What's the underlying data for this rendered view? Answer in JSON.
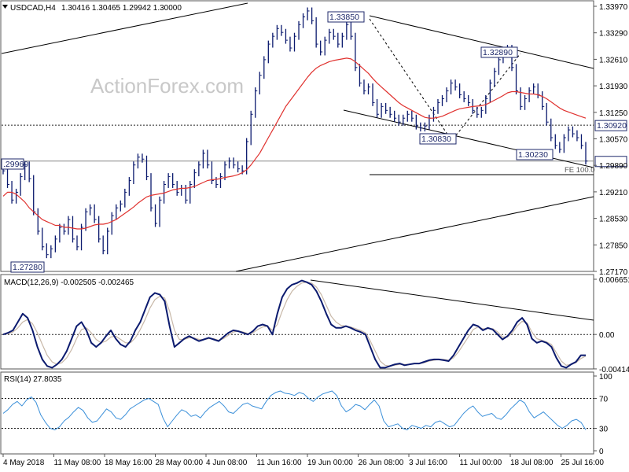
{
  "header": {
    "symbol": "USDCAD,H4",
    "ohlc": "1.30416 1.30465 1.29942 1.30000",
    "watermark": "ActionForex.com"
  },
  "colors": {
    "price_bars": "#0b1a6e",
    "moving_average": "#e0322f",
    "trendline": "#000000",
    "macd_line": "#0b1a6e",
    "macd_signal": "#c8b8a8",
    "rsi_line": "#3a8fd9",
    "grid_dotted": "#222222"
  },
  "chart_data": [
    {
      "type": "line",
      "name": "price",
      "y_axis_ticks": [
        "1.33970",
        "1.33290",
        "1.32610",
        "1.31930",
        "1.31250",
        "1.30570",
        "1.29890",
        "1.29210",
        "1.28530",
        "1.27850",
        "1.27170"
      ],
      "ylim": [
        1.2717,
        1.3397
      ],
      "x_axis_ticks": [
        "4 May 2018",
        "11 May 08:00",
        "18 May 16:00",
        "28 May 00:00",
        "4 Jun 08:00",
        "11 Jun 16:00",
        "19 Jun 00:00",
        "26 Jun 08:00",
        "3 Jul 16:00",
        "11 Jul 00:00",
        "18 Jul 08:00",
        "25 Jul 16:00"
      ],
      "series": [
        {
          "values": [
            1.2975,
            1.294,
            1.29,
            1.292,
            1.296,
            1.299,
            1.2955,
            1.287,
            1.282,
            1.278,
            1.276,
            1.2775,
            1.28,
            1.283,
            1.282,
            1.285,
            1.28,
            1.278,
            1.283,
            1.287,
            1.288,
            1.285,
            1.28,
            1.277,
            1.282,
            1.286,
            1.288,
            1.289,
            1.292,
            1.295,
            1.299,
            1.301,
            1.3005,
            1.296,
            1.288,
            1.284,
            1.29,
            1.294,
            1.296,
            1.294,
            1.292,
            1.293,
            1.29,
            1.294,
            1.297,
            1.299,
            1.302,
            1.299,
            1.295,
            1.294,
            1.296,
            1.299,
            1.3,
            1.299,
            1.298,
            1.2975,
            1.305,
            1.312,
            1.318,
            1.322,
            1.326,
            1.33,
            1.332,
            1.334,
            1.333,
            1.331,
            1.329,
            1.332,
            1.335,
            1.337,
            1.3385,
            1.336,
            1.33,
            1.328,
            1.331,
            1.333,
            1.332,
            1.33,
            1.332,
            1.335,
            1.332,
            1.324,
            1.32,
            1.318,
            1.319,
            1.315,
            1.312,
            1.314,
            1.313,
            1.312,
            1.311,
            1.31,
            1.311,
            1.312,
            1.311,
            1.309,
            1.3085,
            1.309,
            1.311,
            1.313,
            1.315,
            1.316,
            1.318,
            1.32,
            1.319,
            1.317,
            1.316,
            1.315,
            1.313,
            1.312,
            1.313,
            1.316,
            1.32,
            1.323,
            1.326,
            1.328,
            1.3289,
            1.324,
            1.318,
            1.314,
            1.316,
            1.318,
            1.319,
            1.317,
            1.314,
            1.31,
            1.306,
            1.304,
            1.303,
            1.306,
            1.308,
            1.307,
            1.306,
            1.304,
            1.3
          ]
        },
        {
          "name": "MA",
          "values": [
            1.291,
            1.292,
            1.292,
            1.2915,
            1.2905,
            1.2895,
            1.288,
            1.287,
            1.286,
            1.285,
            1.2845,
            1.284,
            1.2835,
            1.2835,
            1.283,
            1.283,
            1.2828,
            1.2826,
            1.2826,
            1.2828,
            1.2832,
            1.2836,
            1.2838,
            1.2838,
            1.284,
            1.2845,
            1.285,
            1.2858,
            1.2866,
            1.2874,
            1.2882,
            1.2892,
            1.29,
            1.2908,
            1.2912,
            1.2914,
            1.2916,
            1.2918,
            1.2922,
            1.2926,
            1.2928,
            1.293,
            1.293,
            1.2932,
            1.2935,
            1.294,
            1.2945,
            1.295,
            1.2952,
            1.2953,
            1.2955,
            1.2958,
            1.296,
            1.2962,
            1.2965,
            1.297,
            1.2978,
            1.299,
            1.3005,
            1.302,
            1.304,
            1.306,
            1.308,
            1.31,
            1.312,
            1.314,
            1.3155,
            1.317,
            1.3185,
            1.32,
            1.3215,
            1.3228,
            1.3238,
            1.3245,
            1.325,
            1.3255,
            1.3258,
            1.326,
            1.3262,
            1.3264,
            1.3262,
            1.3255,
            1.3245,
            1.3235,
            1.3225,
            1.3212,
            1.32,
            1.319,
            1.318,
            1.317,
            1.316,
            1.315,
            1.3142,
            1.3136,
            1.313,
            1.3124,
            1.3118,
            1.3112,
            1.311,
            1.311,
            1.3112,
            1.3115,
            1.312,
            1.3125,
            1.313,
            1.3134,
            1.3136,
            1.3138,
            1.314,
            1.3141,
            1.3142,
            1.3145,
            1.315,
            1.3156,
            1.3162,
            1.3168,
            1.3175,
            1.3178,
            1.3178,
            1.3176,
            1.3174,
            1.3172,
            1.3172,
            1.317,
            1.3166,
            1.316,
            1.3152,
            1.3144,
            1.3136,
            1.313,
            1.3126,
            1.3122,
            1.3118,
            1.3114,
            1.311
          ]
        }
      ],
      "annotations": [
        "1.33850",
        "1.32890",
        "1.30830",
        "1.30230",
        "1.30920",
        "1.30000",
        "1.27280",
        ".29960",
        "FE 100.0"
      ]
    },
    {
      "type": "line",
      "name": "MACD(12,26,9)",
      "title": "MACD(12,26,9) -0.002505 -0.002465",
      "y_axis_ticks": [
        "0.006651",
        "0.00",
        "-0.004145"
      ],
      "ylim": [
        -0.00415,
        0.00665
      ],
      "series": [
        {
          "values": [
            0.0,
            0.0002,
            0.0005,
            0.0015,
            0.0025,
            0.002,
            0.0005,
            -0.0015,
            -0.003,
            -0.0038,
            -0.004,
            -0.0036,
            -0.003,
            -0.002,
            -0.0005,
            0.001,
            0.0015,
            0.0005,
            -0.001,
            -0.0015,
            -0.001,
            -0.0002,
            0.0005,
            -0.0005,
            -0.0012,
            -0.0015,
            -0.0008,
            0.0005,
            0.0015,
            0.003,
            0.0045,
            0.005,
            0.0048,
            0.004,
            0.001,
            -0.0015,
            -0.001,
            -0.0005,
            -0.0002,
            -0.0005,
            -0.0008,
            -0.0006,
            -0.0004,
            -0.0006,
            -0.0008,
            -0.0003,
            0.0002,
            0.0005,
            0.0004,
            0.0002,
            0.0,
            0.0004,
            0.001,
            0.0012,
            0.001,
            0.0,
            0.0025,
            0.0045,
            0.0055,
            0.006,
            0.0062,
            0.0065,
            0.0063,
            0.006,
            0.0052,
            0.004,
            0.0025,
            0.0012,
            0.0008,
            0.0008,
            0.001,
            0.0008,
            0.0005,
            0.0003,
            0.0,
            -0.0015,
            -0.003,
            -0.004,
            -0.004,
            -0.0038,
            -0.0036,
            -0.0035,
            -0.0037,
            -0.0036,
            -0.0035,
            -0.0035,
            -0.0033,
            -0.0031,
            -0.003,
            -0.003,
            -0.0031,
            -0.0032,
            -0.0025,
            -0.0015,
            -0.0005,
            0.0005,
            0.0012,
            0.001,
            0.0005,
            0.0008,
            0.0006,
            0.0,
            -0.0006,
            -0.0002,
            0.0005,
            0.0015,
            0.002,
            0.0012,
            -0.0005,
            -0.001,
            -0.0008,
            -0.001,
            -0.0015,
            -0.0028,
            -0.0038,
            -0.004,
            -0.0036,
            -0.0033,
            -0.0025,
            -0.0025
          ]
        },
        {
          "values": [
            0.0,
            0.0001,
            0.0003,
            0.0008,
            0.0015,
            0.0018,
            0.0013,
            0.0002,
            -0.0012,
            -0.0025,
            -0.0033,
            -0.0036,
            -0.0034,
            -0.0028,
            -0.0018,
            -0.0005,
            0.0006,
            0.0008,
            0.0002,
            -0.0006,
            -0.001,
            -0.0008,
            -0.0003,
            -0.0002,
            -0.0006,
            -0.001,
            -0.001,
            -0.0004,
            0.0006,
            0.0018,
            0.0032,
            0.0042,
            0.0046,
            0.0044,
            0.0028,
            0.0005,
            -0.0006,
            -0.0006,
            -0.0004,
            -0.0004,
            -0.0006,
            -0.0006,
            -0.0005,
            -0.0005,
            -0.0007,
            -0.0005,
            -0.0001,
            0.0003,
            0.0004,
            0.0003,
            0.0001,
            0.0002,
            0.0006,
            0.0009,
            0.001,
            0.0005,
            0.0012,
            0.0028,
            0.0042,
            0.0052,
            0.0058,
            0.0062,
            0.0063,
            0.0062,
            0.0057,
            0.0048,
            0.0035,
            0.0022,
            0.0015,
            0.0011,
            0.001,
            0.0009,
            0.0007,
            0.0005,
            0.0002,
            -0.0008,
            -0.002,
            -0.0032,
            -0.0037,
            -0.0038,
            -0.0037,
            -0.0036,
            -0.0036,
            -0.0036,
            -0.0035,
            -0.0035,
            -0.0034,
            -0.0032,
            -0.0031,
            -0.003,
            -0.003,
            -0.0031,
            -0.0028,
            -0.0021,
            -0.0012,
            -0.0003,
            0.0006,
            0.0009,
            0.0007,
            0.0007,
            0.0007,
            0.0003,
            -0.0003,
            -0.0003,
            0.0002,
            0.001,
            0.0016,
            0.0014,
            0.0003,
            -0.0005,
            -0.0007,
            -0.0009,
            -0.0012,
            -0.0022,
            -0.0032,
            -0.0037,
            -0.0036,
            -0.0034,
            -0.0029,
            -0.0026
          ]
        }
      ]
    },
    {
      "type": "line",
      "name": "RSI(14)",
      "title": "RSI(14) 27.8035",
      "y_axis_ticks": [
        "100",
        "70",
        "30",
        "0"
      ],
      "ylim": [
        0,
        100
      ],
      "series": [
        {
          "values": [
            50,
            55,
            62,
            66,
            60,
            68,
            72,
            65,
            48,
            38,
            30,
            28,
            32,
            40,
            45,
            52,
            58,
            54,
            44,
            38,
            40,
            48,
            56,
            52,
            44,
            42,
            48,
            56,
            60,
            64,
            68,
            70,
            66,
            62,
            44,
            32,
            40,
            48,
            55,
            52,
            46,
            48,
            44,
            52,
            58,
            62,
            66,
            60,
            52,
            50,
            56,
            62,
            64,
            60,
            58,
            56,
            66,
            74,
            78,
            80,
            77,
            76,
            74,
            78,
            76,
            70,
            66,
            72,
            76,
            78,
            80,
            74,
            60,
            52,
            56,
            62,
            60,
            55,
            62,
            68,
            60,
            40,
            32,
            34,
            36,
            30,
            28,
            34,
            32,
            30,
            34,
            32,
            38,
            40,
            36,
            32,
            34,
            42,
            50,
            56,
            60,
            52,
            46,
            48,
            50,
            44,
            42,
            48,
            56,
            62,
            68,
            64,
            52,
            44,
            48,
            52,
            46,
            40,
            34,
            30,
            34,
            40,
            42,
            38,
            28
          ]
        }
      ]
    }
  ]
}
